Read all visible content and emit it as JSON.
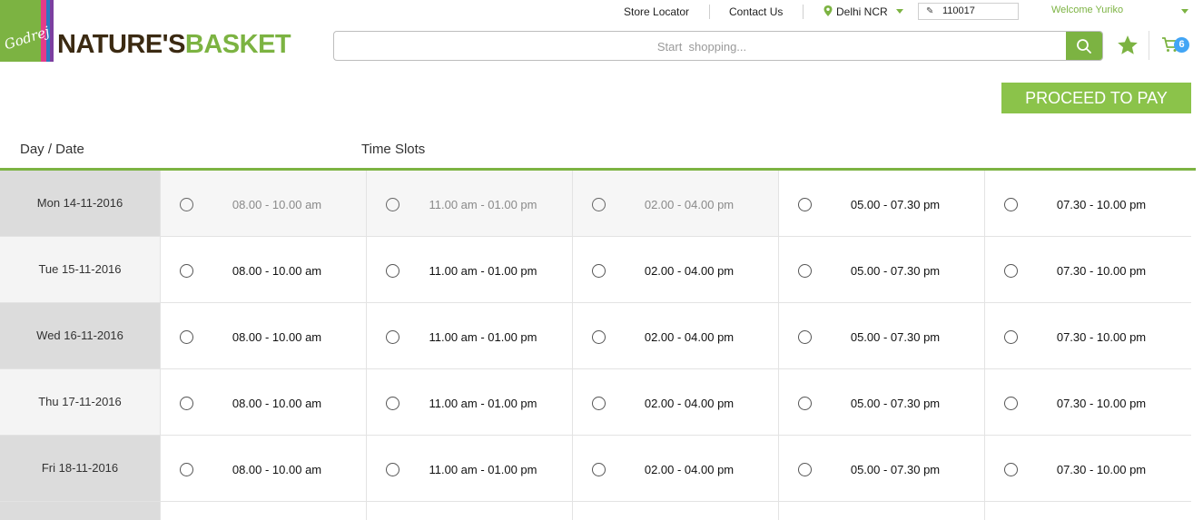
{
  "brand": {
    "parent_script": "Godrej",
    "logo_part1": "NATURE'S",
    "logo_part2": "BASKET",
    "accent_color": "#7cb342"
  },
  "header": {
    "store_locator": "Store Locator",
    "contact_us": "Contact Us",
    "city": "Delhi NCR",
    "pincode": "110017",
    "welcome": "Welcome Yuriko",
    "search_placeholder": "Start  shopping...",
    "cart_count": "6",
    "icons": [
      "location-pin-icon",
      "pencil-icon",
      "search-icon",
      "star-icon",
      "cart-icon"
    ]
  },
  "actions": {
    "proceed_label": "PROCEED TO PAY"
  },
  "table": {
    "head_day": "Day / Date",
    "head_slots": "Time Slots",
    "rows": [
      {
        "date": "Mon 14-11-2016",
        "slots": [
          "08.00 - 10.00 am",
          "11.00 am - 01.00 pm",
          "02.00 - 04.00 pm",
          "05.00 - 07.30 pm",
          "07.30 - 10.00 pm"
        ]
      },
      {
        "date": "Tue 15-11-2016",
        "slots": [
          "08.00 - 10.00 am",
          "11.00 am - 01.00 pm",
          "02.00 - 04.00 pm",
          "05.00 - 07.30 pm",
          "07.30 - 10.00 pm"
        ]
      },
      {
        "date": "Wed 16-11-2016",
        "slots": [
          "08.00 - 10.00 am",
          "11.00 am - 01.00 pm",
          "02.00 - 04.00 pm",
          "05.00 - 07.30 pm",
          "07.30 - 10.00 pm"
        ]
      },
      {
        "date": "Thu 17-11-2016",
        "slots": [
          "08.00 - 10.00 am",
          "11.00 am - 01.00 pm",
          "02.00 - 04.00 pm",
          "05.00 - 07.30 pm",
          "07.30 - 10.00 pm"
        ]
      },
      {
        "date": "Fri 18-11-2016",
        "slots": [
          "08.00 - 10.00 am",
          "11.00 am - 01.00 pm",
          "02.00 - 04.00 pm",
          "05.00 - 07.30 pm",
          "07.30 - 10.00 pm"
        ]
      }
    ],
    "disabled_slots_first_row": 3
  }
}
